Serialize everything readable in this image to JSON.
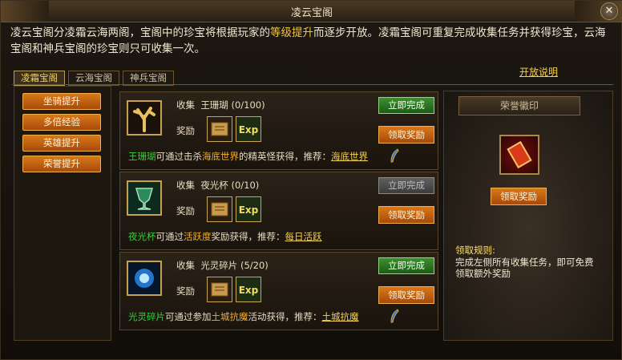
{
  "window": {
    "title": "凌云宝阁",
    "close_label": "✕"
  },
  "description": {
    "part1": "凌云宝阁分凌霜云海两阁，宝阁中的珍宝将根据玩家的",
    "highlight": "等级提升",
    "part2": "而逐步开放。凌霜宝阁可重复完成收集任务并获得珍宝，云海宝阁和神兵宝阁的珍宝则只可收集一次。"
  },
  "tabs": [
    {
      "label": "凌霜宝阁",
      "active": true
    },
    {
      "label": "云海宝阁",
      "active": false
    },
    {
      "label": "神兵宝阁",
      "active": false
    }
  ],
  "help_link": "开放说明",
  "left_menu": [
    "坐骑提升",
    "多倍经验",
    "英雄提升",
    "荣誉提升"
  ],
  "tasks": [
    {
      "collect_prefix": "收集",
      "item_name": "王珊瑚",
      "progress": "(0/100)",
      "reward_label": "奖励",
      "exp_label": "Exp",
      "complete_label": "立即完成",
      "claim_label": "领取奖励",
      "hint_item": "王珊瑚",
      "hint_mid": "可通过击杀",
      "hint_place": "海底世界",
      "hint_tail": "的精英怪获得，推荐：",
      "hint_link": "海底世界"
    },
    {
      "collect_prefix": "收集",
      "item_name": "夜光杯",
      "progress": "(0/10)",
      "reward_label": "奖励",
      "exp_label": "Exp",
      "complete_label": "立即完成",
      "claim_label": "领取奖励",
      "hint_item": "夜光杯",
      "hint_mid": "可通过",
      "hint_place": "活跃度",
      "hint_tail": "奖励获得，推荐：",
      "hint_link": "每日活跃"
    },
    {
      "collect_prefix": "收集",
      "item_name": "光灵碎片",
      "progress": "(5/20)",
      "reward_label": "奖励",
      "exp_label": "Exp",
      "complete_label": "立即完成",
      "claim_label": "领取奖励",
      "hint_item": "光灵碎片",
      "hint_mid": "可通过参加",
      "hint_place": "土城抗魔",
      "hint_tail": "活动获得，推荐：",
      "hint_link": "土城抗魔"
    }
  ],
  "honor_panel": {
    "title": "荣誉徽印",
    "claim_label": "领取奖励",
    "rule_title": "领取规则:",
    "rule_text": "完成左侧所有收集任务，即可免费领取额外奖励"
  }
}
